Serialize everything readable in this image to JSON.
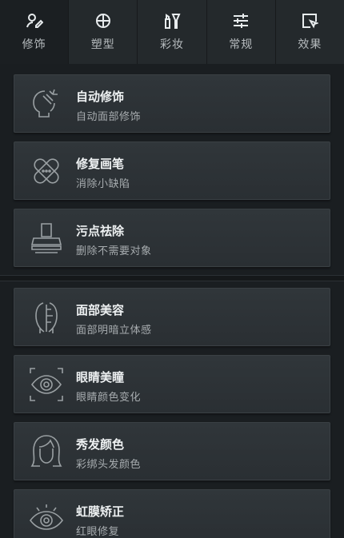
{
  "tabs": [
    {
      "label": "修饰",
      "icon": "retouch-icon",
      "active": true
    },
    {
      "label": "塑型",
      "icon": "crosshair-icon",
      "active": false
    },
    {
      "label": "彩妆",
      "icon": "makeup-icon",
      "active": false
    },
    {
      "label": "常规",
      "icon": "sliders-icon",
      "active": false
    },
    {
      "label": "效果",
      "icon": "effects-icon",
      "active": false
    }
  ],
  "groups": [
    {
      "items": [
        {
          "title": "自动修饰",
          "subtitle": "自动面部修饰",
          "icon": "auto-face-icon"
        },
        {
          "title": "修复画笔",
          "subtitle": "消除小缺陷",
          "icon": "bandage-icon"
        },
        {
          "title": "污点祛除",
          "subtitle": "删除不需要对象",
          "icon": "stamp-icon"
        }
      ]
    },
    {
      "items": [
        {
          "title": "面部美容",
          "subtitle": "面部明暗立体感",
          "icon": "face-contour-icon"
        },
        {
          "title": "眼睛美瞳",
          "subtitle": "眼睛颜色变化",
          "icon": "eye-focus-icon"
        },
        {
          "title": "秀发颜色",
          "subtitle": "彩绑头发颜色",
          "icon": "hair-icon"
        },
        {
          "title": "虹膜矫正",
          "subtitle": "红眼修复",
          "icon": "iris-icon"
        }
      ]
    }
  ]
}
